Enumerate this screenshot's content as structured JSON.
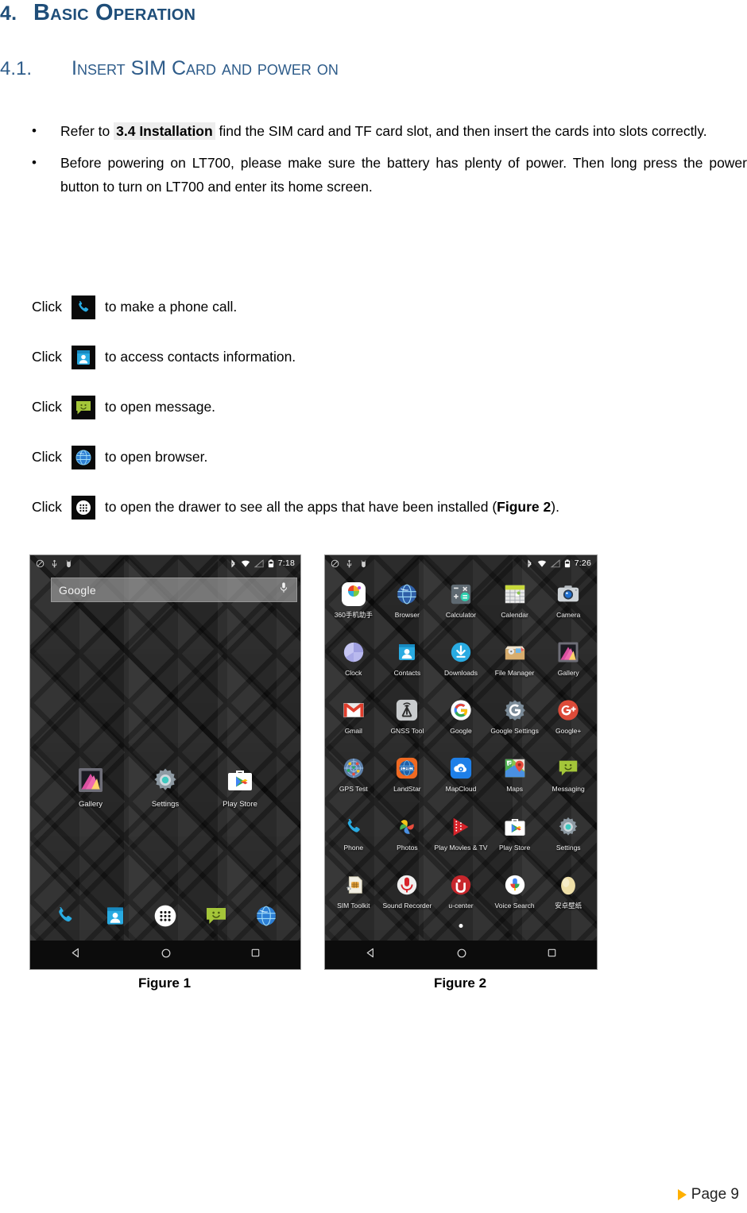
{
  "document": {
    "heading1": {
      "number": "4.",
      "title": "Basic Operation"
    },
    "heading2": {
      "number": "4.1.",
      "title": "Insert SIM Card and power on"
    },
    "bullets": [
      {
        "pre": "Refer to ",
        "highlight": "3.4 Installation",
        "post": " find the SIM card and TF card slot, and then insert the cards into slots correctly."
      },
      {
        "pre": "Before powering on LT700, please make sure the battery has plenty of power. Then long press the power button to turn on LT700 and enter its home screen.",
        "highlight": "",
        "post": ""
      }
    ],
    "click_lines": [
      {
        "label": "Click",
        "icon": "phone-icon",
        "text": "to make a phone call.",
        "bold": "",
        "tail": ""
      },
      {
        "label": "Click",
        "icon": "contacts-icon",
        "text": "to access contacts information.",
        "bold": "",
        "tail": ""
      },
      {
        "label": "Click",
        "icon": "messaging-icon",
        "text": "to open message.",
        "bold": "",
        "tail": ""
      },
      {
        "label": "Click",
        "icon": "browser-icon",
        "text": "to open browser.",
        "bold": "",
        "tail": ""
      },
      {
        "label": "Click",
        "icon": "app-drawer-icon",
        "text": "to open the drawer to see all the apps that have been installed (",
        "bold": "Figure 2",
        "tail": ")."
      }
    ],
    "figure1": {
      "caption": "Figure 1",
      "status_bar": {
        "time": "7:18",
        "left_icons": [
          "do-not-disturb-icon",
          "usb-icon",
          "android-debug-icon"
        ],
        "right_icons": [
          "bluetooth-icon",
          "wifi-icon",
          "signal-icon",
          "battery-icon"
        ]
      },
      "search": {
        "text": "Google",
        "mic": "microphone-icon"
      },
      "home_icons": [
        {
          "label": "Gallery",
          "icon": "gallery-icon"
        },
        {
          "label": "Settings",
          "icon": "settings-icon"
        },
        {
          "label": "Play Store",
          "icon": "play-store-icon"
        }
      ],
      "dock": [
        {
          "label": "Phone",
          "icon": "phone-icon"
        },
        {
          "label": "Contacts",
          "icon": "contacts-icon"
        },
        {
          "label": "Apps",
          "icon": "app-drawer-icon"
        },
        {
          "label": "Messaging",
          "icon": "messaging-icon"
        },
        {
          "label": "Browser",
          "icon": "browser-icon"
        }
      ],
      "nav": [
        "back-icon",
        "home-icon",
        "recents-icon"
      ]
    },
    "figure2": {
      "caption": "Figure 2",
      "status_bar": {
        "time": "7:26",
        "left_icons": [
          "do-not-disturb-icon",
          "usb-icon",
          "android-debug-icon"
        ],
        "right_icons": [
          "bluetooth-icon",
          "wifi-icon",
          "signal-icon",
          "battery-icon"
        ]
      },
      "apps": [
        {
          "label": "360手机助手",
          "icon": "360-assistant-icon"
        },
        {
          "label": "Browser",
          "icon": "browser-icon"
        },
        {
          "label": "Calculator",
          "icon": "calculator-icon"
        },
        {
          "label": "Calendar",
          "icon": "calendar-icon"
        },
        {
          "label": "Camera",
          "icon": "camera-icon"
        },
        {
          "label": "Clock",
          "icon": "clock-icon"
        },
        {
          "label": "Contacts",
          "icon": "contacts-icon"
        },
        {
          "label": "Downloads",
          "icon": "downloads-icon"
        },
        {
          "label": "File Manager",
          "icon": "file-manager-icon"
        },
        {
          "label": "Gallery",
          "icon": "gallery-icon"
        },
        {
          "label": "Gmail",
          "icon": "gmail-icon"
        },
        {
          "label": "GNSS Tool",
          "icon": "gnss-tool-icon"
        },
        {
          "label": "Google",
          "icon": "google-icon"
        },
        {
          "label": "Google Settings",
          "icon": "google-settings-icon"
        },
        {
          "label": "Google+",
          "icon": "google-plus-icon"
        },
        {
          "label": "GPS Test",
          "icon": "gps-test-icon"
        },
        {
          "label": "LandStar",
          "icon": "landstar-icon"
        },
        {
          "label": "MapCloud",
          "icon": "mapcloud-icon"
        },
        {
          "label": "Maps",
          "icon": "maps-icon"
        },
        {
          "label": "Messaging",
          "icon": "messaging-icon"
        },
        {
          "label": "Phone",
          "icon": "phone-icon"
        },
        {
          "label": "Photos",
          "icon": "photos-icon"
        },
        {
          "label": "Play Movies & TV",
          "icon": "play-movies-icon"
        },
        {
          "label": "Play Store",
          "icon": "play-store-icon"
        },
        {
          "label": "Settings",
          "icon": "settings-icon"
        },
        {
          "label": "SIM Toolkit",
          "icon": "sim-toolkit-icon"
        },
        {
          "label": "Sound Recorder",
          "icon": "sound-recorder-icon"
        },
        {
          "label": "u-center",
          "icon": "u-center-icon"
        },
        {
          "label": "Voice Search",
          "icon": "voice-search-icon"
        },
        {
          "label": "安卓壁纸",
          "icon": "android-wallpaper-icon"
        }
      ],
      "nav": [
        "back-icon",
        "home-icon",
        "recents-icon"
      ]
    },
    "footer": {
      "page_label": "Page 9",
      "marker": "triangle-marker"
    },
    "colors": {
      "heading1": "#1F4E79",
      "heading2": "#2E5C8A",
      "highlight_bg": "#EDEDED",
      "footer_marker": "#FFB000"
    }
  }
}
